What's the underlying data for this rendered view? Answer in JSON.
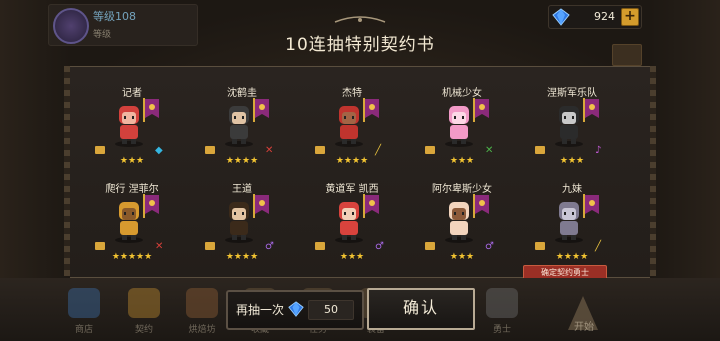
{
  "player": {
    "level_text": "等级108",
    "subtitle": "等级"
  },
  "currency": {
    "gems": "924",
    "plus": "+",
    "icon": "gem-icon",
    "accent": "#d59c2c"
  },
  "title": "10连抽特别契约书",
  "heroes": [
    {
      "name": "记者",
      "stars": "★★★",
      "weapon": "◆",
      "weapon_color": "#35b6e0",
      "icon": "blue-gem-weapon-icon"
    },
    {
      "name": "沈鹤圭",
      "stars": "★★★★",
      "weapon": "✕",
      "weapon_color": "#d6403a",
      "icon": "crossed-swords-icon"
    },
    {
      "name": "杰特",
      "stars": "★★★★",
      "weapon": "╱",
      "weapon_color": "#e6c13f",
      "icon": "gold-sword-icon"
    },
    {
      "name": "机械少女",
      "stars": "★★★",
      "weapon": "✕",
      "weapon_color": "#4cb24a",
      "icon": "green-weapon-icon"
    },
    {
      "name": "涅斯军乐队",
      "stars": "★★★",
      "weapon": "♪",
      "weapon_color": "#c45bd8",
      "icon": "purple-flask-icon"
    },
    {
      "name": "爬行 涅菲尔",
      "stars": "★★★★★",
      "weapon": "✕",
      "weapon_color": "#d6403a",
      "icon": "crossed-swords-icon"
    },
    {
      "name": "王道",
      "stars": "★★★★",
      "weapon": "♂",
      "weapon_color": "#a466e0",
      "icon": "purple-staff-icon"
    },
    {
      "name": "黄道军 凯西",
      "stars": "★★★",
      "weapon": "♂",
      "weapon_color": "#a466e0",
      "icon": "purple-staff-icon"
    },
    {
      "name": "阿尔卑斯少女",
      "stars": "★★★",
      "weapon": "♂",
      "weapon_color": "#a466e0",
      "icon": "purple-staff-icon"
    },
    {
      "name": "九妹",
      "stars": "★★★★",
      "weapon": "╱",
      "weapon_color": "#e6c13f",
      "icon": "gold-sword-icon"
    }
  ],
  "contract_tag": "确定契约勇士",
  "draw_again": {
    "label": "再抽一次",
    "cost": "50"
  },
  "confirm": "确认",
  "bottom_nav": [
    {
      "label": "商店"
    },
    {
      "label": "契约"
    },
    {
      "label": "烘焙坊"
    },
    {
      "label": "收藏"
    },
    {
      "label": "任务"
    },
    {
      "label": "装备"
    },
    {
      "label": "勇士"
    }
  ],
  "start": "开始"
}
